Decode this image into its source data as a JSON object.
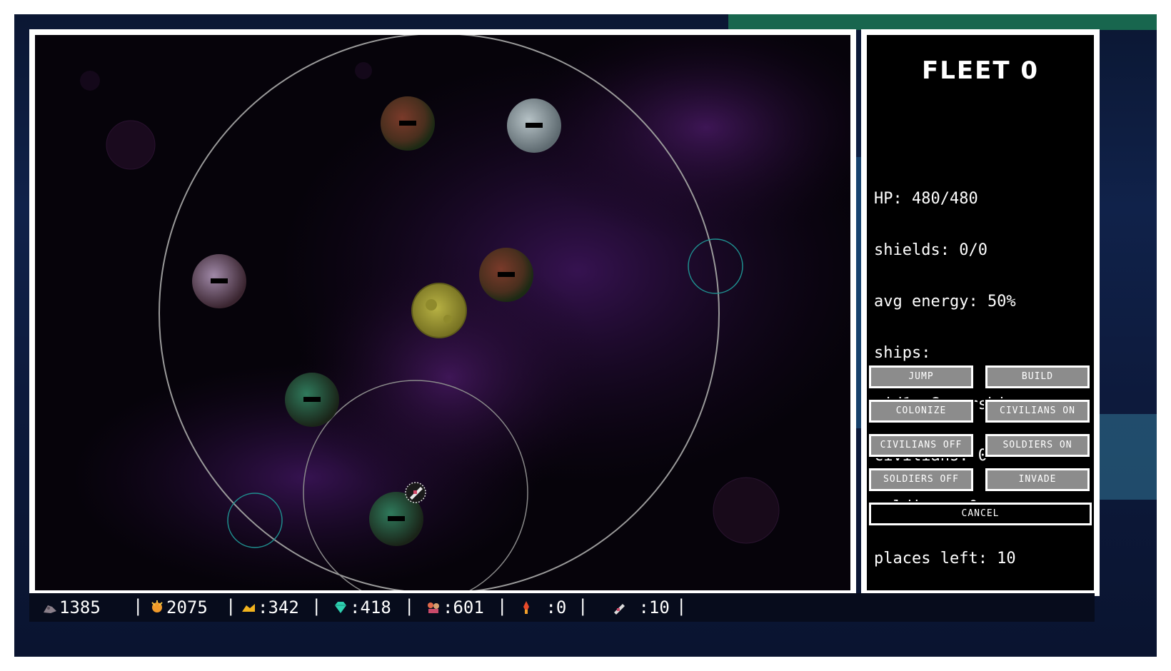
{
  "fleet_panel": {
    "title": "FLEET 0",
    "stats": {
      "hp": "HP: 480/480",
      "shields": "shields: 0/0",
      "avg_energy": "avg energy: 50%",
      "ships_label": "ships:",
      "ship_entry": " id1: Supership",
      "civilians": "civilians: 0",
      "soldiers": "soldiers: 0",
      "places_left": "places left: 10"
    },
    "buttons": {
      "jump": "JUMP",
      "build": "BUILD",
      "colonize": "COLONIZE",
      "civilians_on": "CIVILIANS ON",
      "civilians_off": "CIVILIANS OFF",
      "soldiers_on": "SOLDIERS ON",
      "soldiers_off": "SOLDIERS OFF",
      "invade": "INVADE",
      "cancel": "CANCEL"
    }
  },
  "resources": [
    {
      "icon": "ore-icon",
      "value": "1385"
    },
    {
      "icon": "energy-icon",
      "value": "2075"
    },
    {
      "icon": "gold-icon",
      "value": ":342"
    },
    {
      "icon": "crystal-icon",
      "value": ":418"
    },
    {
      "icon": "population-icon",
      "value": ":601"
    },
    {
      "icon": "soldier-icon",
      "value": " :0"
    },
    {
      "icon": "rocket-icon",
      "value": " :10"
    }
  ],
  "separator": "|",
  "colors": {
    "panel_border": "#ffffff",
    "button_bg": "#8c8c8c",
    "orbit_ring": "#9a9a9a",
    "warp_ring": "#1f8f8f",
    "sun": "#a9a33a"
  }
}
